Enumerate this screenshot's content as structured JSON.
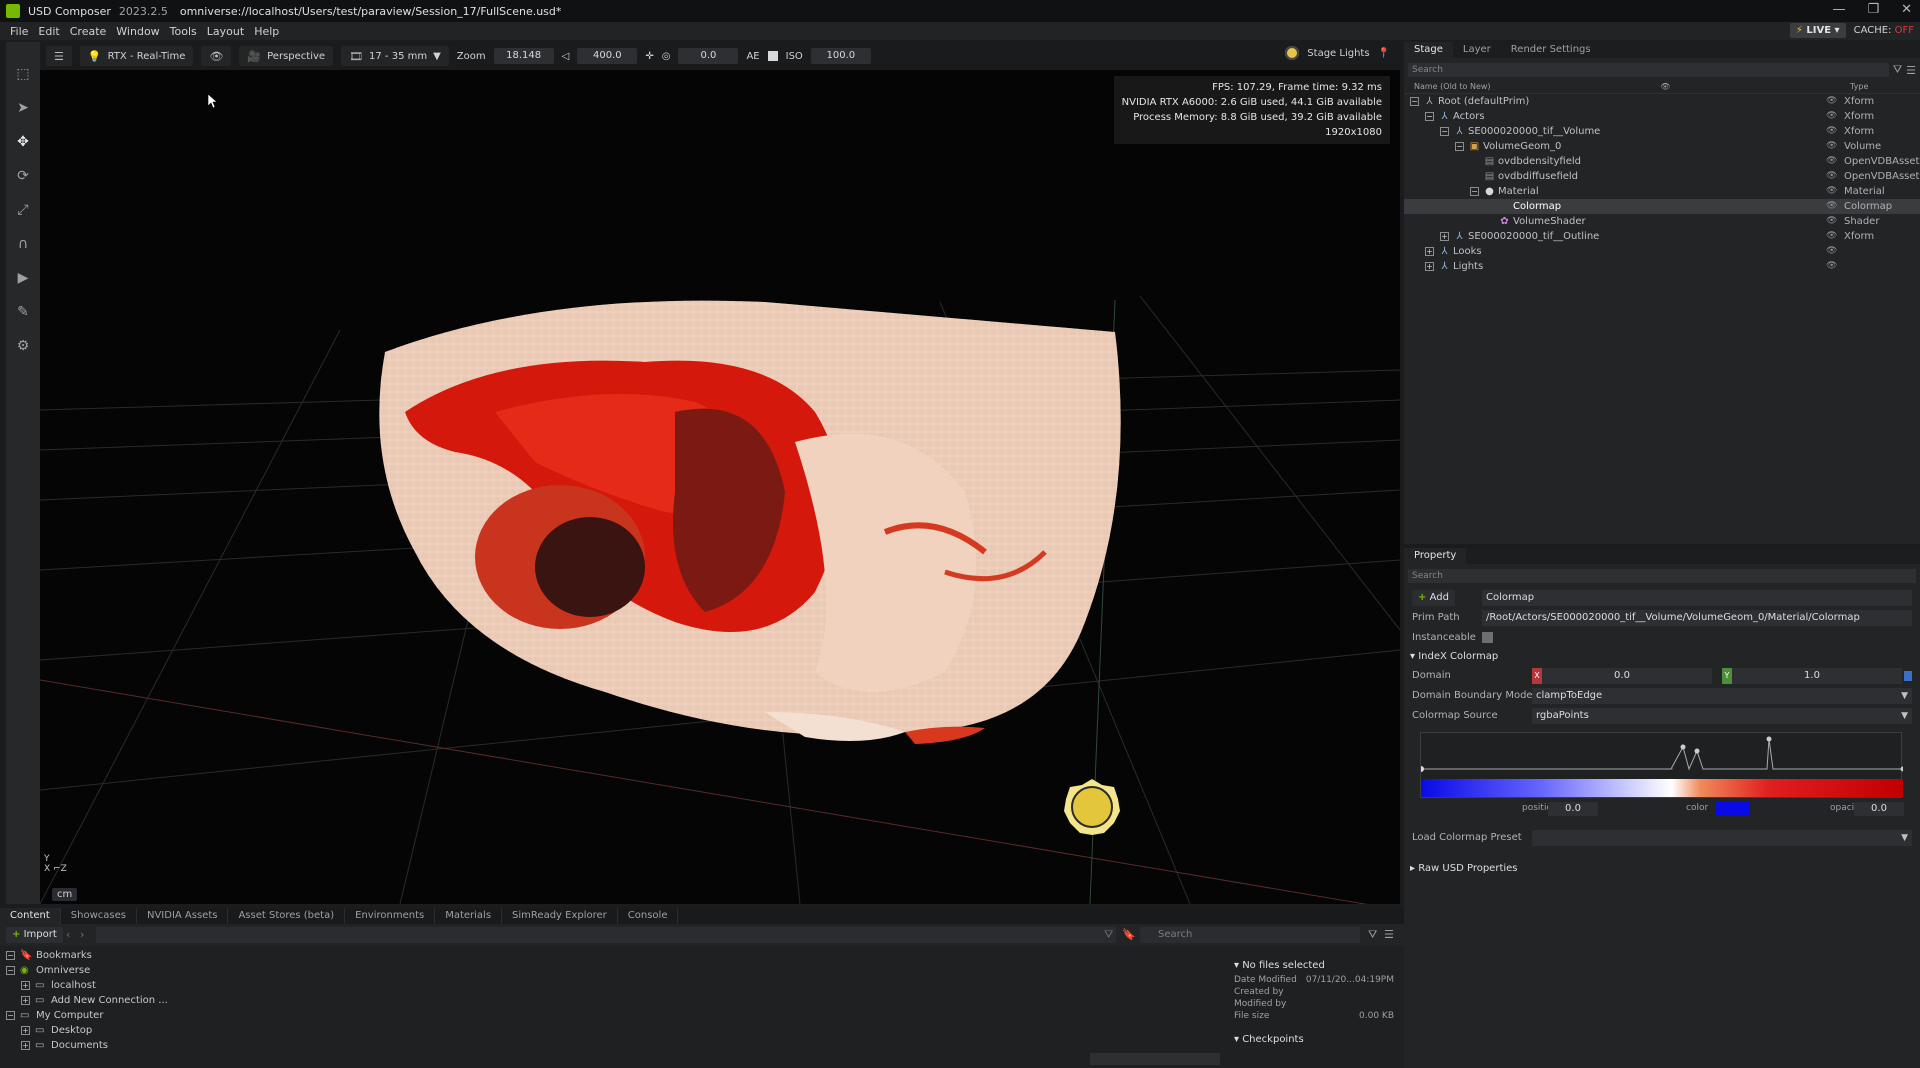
{
  "titlebar": {
    "app": "USD Composer",
    "version": "2023.2.5",
    "path": "omniverse://localhost/Users/test/paraview/Session_17/FullScene.usd*"
  },
  "menu": [
    "File",
    "Edit",
    "Create",
    "Window",
    "Tools",
    "Layout",
    "Help"
  ],
  "status": {
    "live": "LIVE",
    "cache_label": "CACHE:",
    "cache_state": "OFF"
  },
  "viewport": {
    "renderer": "RTX - Real-Time",
    "camera": "Perspective",
    "lens": "17 - 35 mm",
    "zoom_label": "Zoom",
    "zoom_value": "18.148",
    "speed": "400.0",
    "exposure": "0.0",
    "ae_label": "AE",
    "iso_label": "ISO",
    "iso_value": "100.0",
    "stage_lights": "Stage Lights",
    "stats": [
      "FPS: 107.29, Frame time: 9.32 ms",
      "NVIDIA RTX A6000: 2.6 GiB used, 44.1 GiB available",
      "Process Memory: 8.8 GiB used, 39.2 GiB available",
      "1920x1080"
    ],
    "unit": "cm"
  },
  "stage": {
    "tabs": [
      "Stage",
      "Layer",
      "Render Settings"
    ],
    "search_placeholder": "Search",
    "col_name": "Name (Old to New)",
    "col_type": "Type",
    "rows": [
      {
        "label": "Root (defaultPrim)",
        "type": "Xform",
        "level": 0,
        "exp": "−",
        "icon": "xform"
      },
      {
        "label": "Actors",
        "type": "Xform",
        "level": 1,
        "exp": "−",
        "icon": "xform"
      },
      {
        "label": "SE000020000_tif__Volume",
        "type": "Xform",
        "level": 2,
        "exp": "−",
        "icon": "xform"
      },
      {
        "label": "VolumeGeom_0",
        "type": "Volume",
        "level": 3,
        "exp": "−",
        "icon": "volume"
      },
      {
        "label": "ovdbdensityfield",
        "type": "OpenVDBAsset",
        "level": 4,
        "exp": "",
        "icon": "asset"
      },
      {
        "label": "ovdbdiffusefield",
        "type": "OpenVDBAsset",
        "level": 4,
        "exp": "",
        "icon": "asset"
      },
      {
        "label": "Material",
        "type": "Material",
        "level": 4,
        "exp": "−",
        "icon": "material"
      },
      {
        "label": "Colormap",
        "type": "Colormap",
        "level": 5,
        "exp": "",
        "icon": "none",
        "selected": true
      },
      {
        "label": "VolumeShader",
        "type": "Shader",
        "level": 5,
        "exp": "",
        "icon": "shader"
      },
      {
        "label": "SE000020000_tif__Outline",
        "type": "Xform",
        "level": 2,
        "exp": "+",
        "icon": "xform"
      },
      {
        "label": "Looks",
        "type": "",
        "level": 1,
        "exp": "+",
        "icon": "xform"
      },
      {
        "label": "Lights",
        "type": "",
        "level": 1,
        "exp": "+",
        "icon": "xform"
      }
    ]
  },
  "property": {
    "tab": "Property",
    "search_placeholder": "Search",
    "add_label": "Add",
    "name_value": "Colormap",
    "prim_path_label": "Prim Path",
    "prim_path": "/Root/Actors/SE000020000_tif__Volume/VolumeGeom_0/Material/Colormap",
    "instanceable_label": "Instanceable",
    "section": "IndeX Colormap",
    "domain_label": "Domain",
    "domain_x_tag": "X",
    "domain_x": "0.0",
    "domain_y_tag": "Y",
    "domain_y": "1.0",
    "boundary_label": "Domain Boundary Mode",
    "boundary_value": "clampToEdge",
    "source_label": "Colormap Source",
    "source_value": "rgbaPoints",
    "position_label": "position",
    "position_value": "0.0",
    "color_label": "color",
    "color_value": "#0a0ae6",
    "opacity_label": "opacity",
    "opacity_value": "0.0",
    "preset_label": "Load Colormap Preset",
    "raw_section": "Raw USD Properties"
  },
  "content": {
    "tabs": [
      "Content",
      "Showcases",
      "NVIDIA Assets",
      "Asset Stores (beta)",
      "Environments",
      "Materials",
      "SimReady Explorer",
      "Console"
    ],
    "import_label": "Import",
    "search_placeholder": "Search",
    "tree": [
      {
        "label": "Bookmarks",
        "level": 0,
        "exp": "−",
        "icon": "bookmark"
      },
      {
        "label": "Omniverse",
        "level": 0,
        "exp": "−",
        "icon": "omni"
      },
      {
        "label": "localhost",
        "level": 1,
        "exp": "+",
        "icon": "server"
      },
      {
        "label": "Add New Connection ...",
        "level": 1,
        "exp": "+",
        "icon": "server"
      },
      {
        "label": "My Computer",
        "level": 0,
        "exp": "−",
        "icon": "computer"
      },
      {
        "label": "Desktop",
        "level": 1,
        "exp": "+",
        "icon": "folder"
      },
      {
        "label": "Documents",
        "level": 1,
        "exp": "+",
        "icon": "folder"
      }
    ],
    "details": {
      "header": "No files selected",
      "date_label": "Date Modified",
      "date_value": "07/11/20...04:19PM",
      "created_label": "Created by",
      "modified_label": "Modified by",
      "size_label": "File size",
      "size_value": "0.00 KB",
      "checkpoints": "Checkpoints"
    }
  }
}
